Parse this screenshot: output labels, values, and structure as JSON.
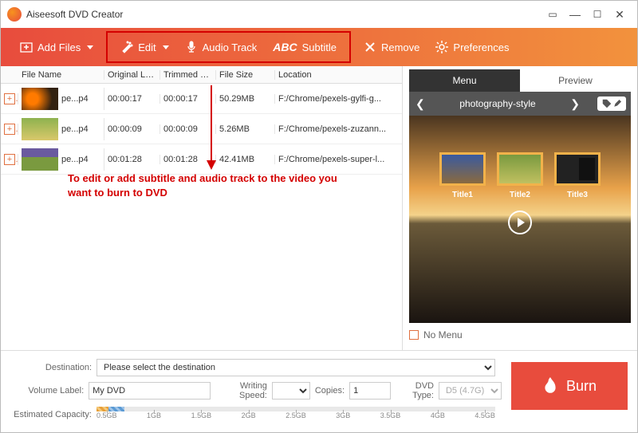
{
  "app": {
    "title": "Aiseesoft DVD Creator"
  },
  "toolbar": {
    "add_files": "Add Files",
    "edit": "Edit",
    "audio_track": "Audio Track",
    "subtitle": "Subtitle",
    "remove": "Remove",
    "preferences": "Preferences"
  },
  "columns": {
    "file_name": "File Name",
    "original_length": "Original Leng",
    "trimmed_length": "Trimmed Len",
    "file_size": "File Size",
    "location": "Location"
  },
  "files": [
    {
      "name": "pe...p4",
      "olen": "00:00:17",
      "tlen": "00:00:17",
      "size": "50.29MB",
      "loc": "F:/Chrome/pexels-gylfi-g..."
    },
    {
      "name": "pe...p4",
      "olen": "00:00:09",
      "tlen": "00:00:09",
      "size": "5.26MB",
      "loc": "F:/Chrome/pexels-zuzann..."
    },
    {
      "name": "pe...p4",
      "olen": "00:01:28",
      "tlen": "00:01:28",
      "size": "42.41MB",
      "loc": "F:/Chrome/pexels-super-l..."
    }
  ],
  "annotation": "To edit or add subtitle and audio track to the video you want to burn to DVD",
  "right": {
    "tab_menu": "Menu",
    "tab_preview": "Preview",
    "style_name": "photography-style",
    "titles": [
      "Title1",
      "Title2",
      "Title3"
    ],
    "no_menu": "No Menu"
  },
  "bottom": {
    "destination_label": "Destination:",
    "destination_value": "Please select the destination",
    "volume_label_label": "Volume Label:",
    "volume_label_value": "My DVD",
    "writing_speed_label": "Writing Speed:",
    "writing_speed_value": "",
    "copies_label": "Copies:",
    "copies_value": "1",
    "dvd_type_label": "DVD Type:",
    "dvd_type_value": "D5 (4.7G)",
    "capacity_label": "Estimated Capacity:",
    "ticks": [
      "0.5GB",
      "1GB",
      "1.5GB",
      "2GB",
      "2.5GB",
      "3GB",
      "3.5GB",
      "4GB",
      "4.5GB"
    ]
  },
  "burn_label": "Burn"
}
